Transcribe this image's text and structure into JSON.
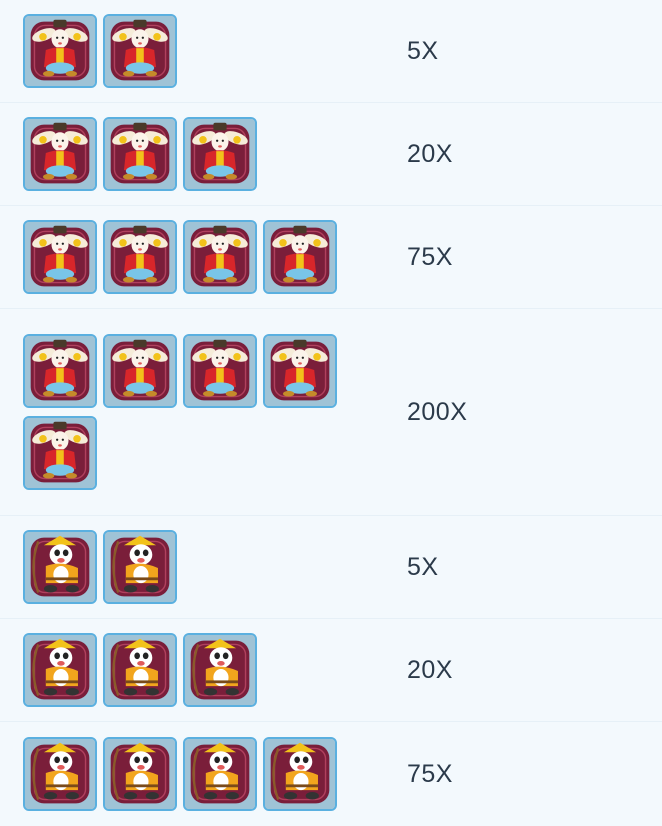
{
  "paytable": {
    "rows": [
      {
        "symbol": "rabbit-symbol",
        "count": 2,
        "multiplier": "5X"
      },
      {
        "symbol": "rabbit-symbol",
        "count": 3,
        "multiplier": "20X"
      },
      {
        "symbol": "rabbit-symbol",
        "count": 4,
        "multiplier": "75X"
      },
      {
        "symbol": "rabbit-symbol",
        "count": 5,
        "multiplier": "200X"
      },
      {
        "symbol": "panda-archer-symbol",
        "count": 2,
        "multiplier": "5X"
      },
      {
        "symbol": "panda-archer-symbol",
        "count": 3,
        "multiplier": "20X"
      },
      {
        "symbol": "panda-archer-symbol",
        "count": 4,
        "multiplier": "75X"
      }
    ]
  },
  "colors": {
    "background": "#f3f9fd",
    "tile_border": "#5ab0e0",
    "frame_maroon": "#7a1e3a",
    "rabbit_robe": "#d8262a",
    "panda_robe": "#f2a51d",
    "text": "#2b3a4a"
  }
}
